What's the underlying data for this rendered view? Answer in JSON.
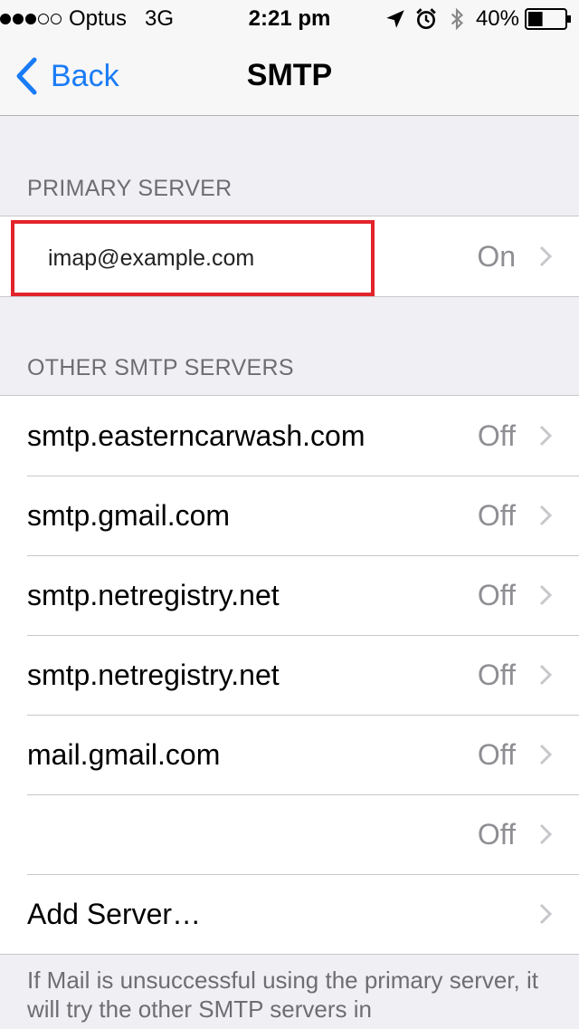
{
  "status_bar": {
    "carrier": "Optus",
    "network": "3G",
    "time": "2:21 pm",
    "battery": "40%",
    "battery_level": 0.4,
    "signal_bars_filled": 3,
    "signal_bars_total": 5,
    "icons": [
      "location-arrow-icon",
      "alarm-icon",
      "bluetooth-icon",
      "battery-icon"
    ]
  },
  "nav": {
    "back_label": "Back",
    "title": "SMTP"
  },
  "primary": {
    "header": "PRIMARY SERVER",
    "server": "imap@example.com",
    "value": "On"
  },
  "other": {
    "header": "OTHER SMTP SERVERS",
    "items": [
      {
        "label": "smtp.easterncarwash.com",
        "value": "Off"
      },
      {
        "label": "smtp.gmail.com",
        "value": "Off"
      },
      {
        "label": "smtp.netregistry.net",
        "value": "Off"
      },
      {
        "label": "smtp.netregistry.net",
        "value": "Off"
      },
      {
        "label": "mail.gmail.com",
        "value": "Off"
      },
      {
        "label": "",
        "value": "Off"
      },
      {
        "label": "Add Server…",
        "value": ""
      }
    ]
  },
  "footer": "If Mail is unsuccessful using the primary server, it will try the other SMTP servers in",
  "colors": {
    "accent": "#1a7cf5",
    "highlight": "#e2232a",
    "secondary_text": "#8e8e93"
  }
}
